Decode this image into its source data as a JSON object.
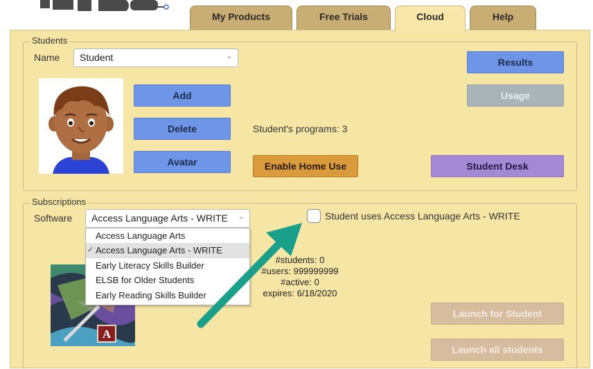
{
  "tabs": [
    {
      "label": "My Products"
    },
    {
      "label": "Free Trials"
    },
    {
      "label": "Cloud"
    },
    {
      "label": "Help"
    }
  ],
  "students": {
    "legend": "Students",
    "name_label": "Name",
    "name_value": "Student",
    "programs_text": "Student's programs: 3",
    "buttons": {
      "add": "Add",
      "delete": "Delete",
      "avatar": "Avatar",
      "results": "Results",
      "usage": "Usage",
      "home_use": "Enable Home Use",
      "student_desk": "Student Desk"
    }
  },
  "subscriptions": {
    "legend": "Subscriptions",
    "software_label": "Software",
    "software_value": "Access Language Arts - WRITE",
    "options": [
      "Access Language Arts",
      "Access Language Arts - WRITE",
      "Early Literacy Skills Builder",
      "ELSB for Older Students",
      "Early Reading Skills Builder"
    ],
    "selected_index": 1,
    "checkbox_label": "Student uses Access Language Arts - WRITE",
    "checkbox_checked": false,
    "stats": {
      "students": "#students: 0",
      "users": "#users: 999999999",
      "active": "#active: 0",
      "expires": "expires: 6/18/2020"
    },
    "buttons": {
      "launch_student": "Launch for Student",
      "launch_all": "Launch all students"
    },
    "cover_badge": "A"
  },
  "colors": {
    "panel": "#f6e6a6",
    "tab_inactive": "#c8ae72",
    "button_blue": "#6f95e6",
    "button_orange": "#d99b3c",
    "button_purple": "#a48ad4",
    "arrow": "#1aa08a"
  }
}
